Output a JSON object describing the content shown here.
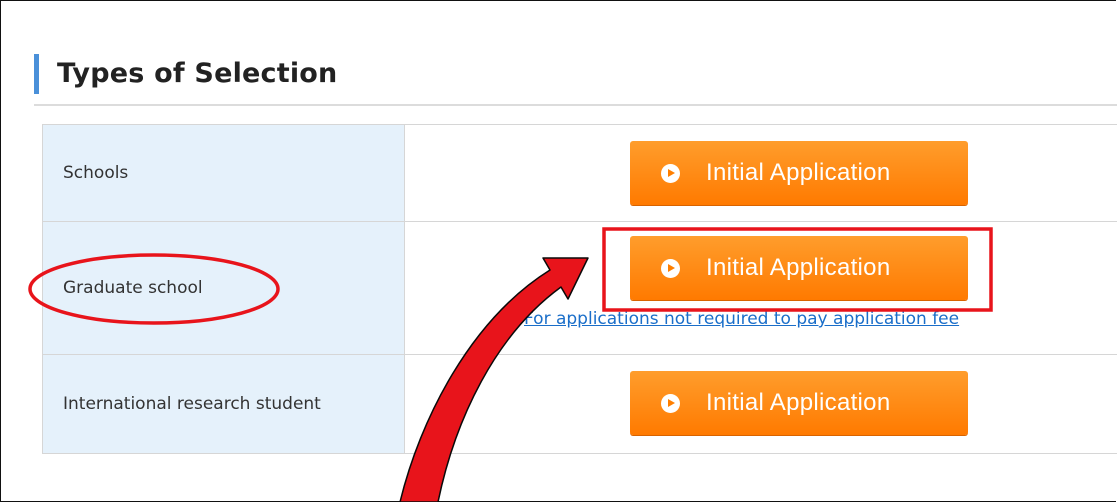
{
  "section": {
    "title": "Types of Selection"
  },
  "rows": [
    {
      "label": "Schools",
      "button_label": "Initial Application"
    },
    {
      "label": "Graduate school",
      "button_label": "Initial Application",
      "link_text": "For applications not required to pay application fee"
    },
    {
      "label": "International research student",
      "button_label": "Initial Application"
    }
  ],
  "colors": {
    "accent": "#4a90d9",
    "button": "#ff8200",
    "label_bg": "#e5f1fb",
    "link": "#1a6ec9",
    "annotation": "#e8141b"
  },
  "icons": {
    "button": "play-circle-icon",
    "link": "link-bullet-icon"
  }
}
